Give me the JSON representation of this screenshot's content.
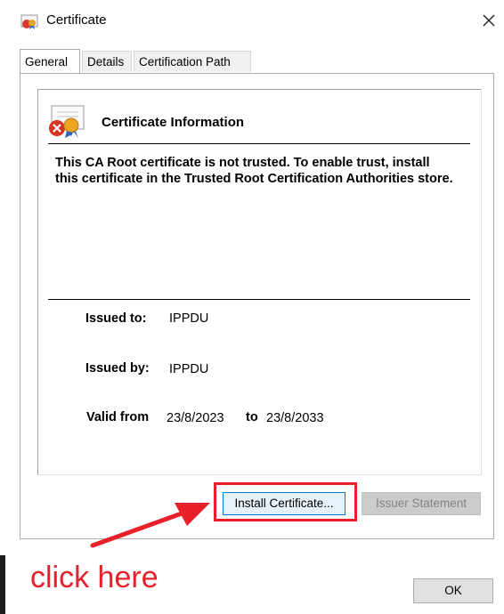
{
  "window": {
    "title": "Certificate",
    "close_symbol": "✕"
  },
  "tabs": [
    {
      "label": "General",
      "active": true
    },
    {
      "label": "Details",
      "active": false
    },
    {
      "label": "Certification Path",
      "active": false
    }
  ],
  "general": {
    "heading": "Certificate Information",
    "notice": "This CA Root certificate is not trusted. To enable trust, install this certificate in the Trusted Root Certification Authorities store.",
    "issued_to_label": "Issued to:",
    "issued_to_value": "IPPDU",
    "issued_by_label": "Issued by:",
    "issued_by_value": "IPPDU",
    "valid_from_label": "Valid from",
    "valid_from_value": "23/8/2023",
    "valid_to_label": "to",
    "valid_to_value": "23/8/2033"
  },
  "buttons": {
    "install": "Install Certificate...",
    "issuer": "Issuer Statement",
    "ok": "OK"
  },
  "annotation": {
    "text": "click here",
    "color": "#e8202a"
  },
  "icons": {
    "title": "certificate-icon",
    "certificate_info": "untrusted-certificate-icon"
  }
}
